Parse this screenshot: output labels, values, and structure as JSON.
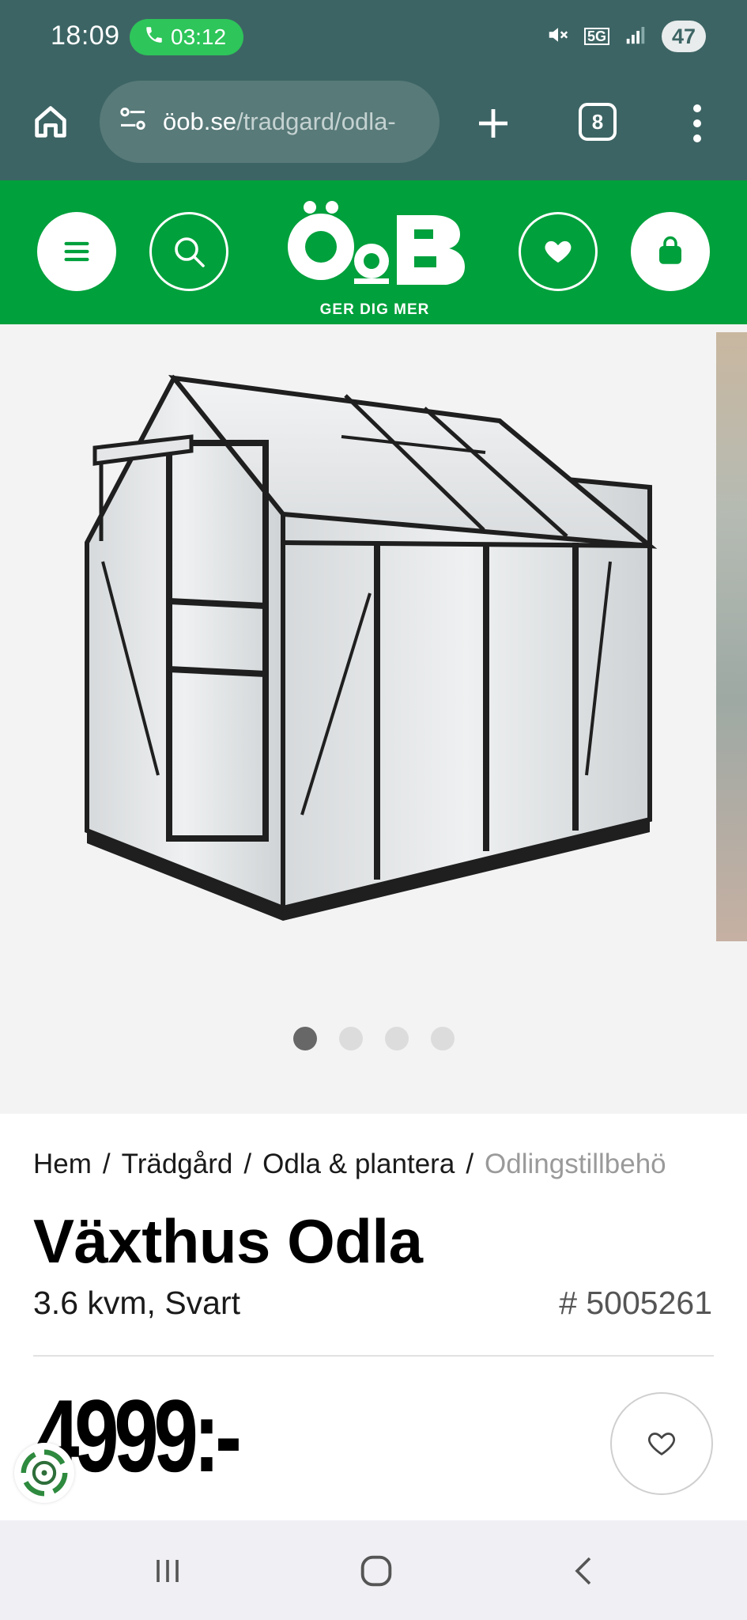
{
  "status_bar": {
    "time": "18:09",
    "call_timer": "03:12",
    "battery": "47",
    "network": "5G"
  },
  "browser": {
    "url_domain": "öob.se",
    "url_path": "/tradgard/odla-",
    "tab_count": "8"
  },
  "header": {
    "logo_text": "ÖoB",
    "logo_tagline": "GER DIG MER",
    "brand_color": "#00a03c"
  },
  "gallery": {
    "image_count": 4,
    "active_index": 1
  },
  "breadcrumb": {
    "items": [
      "Hem",
      "Trädgård",
      "Odla & plantera",
      "Odlingstillbehö"
    ],
    "separator": "/"
  },
  "product": {
    "title": "Växthus Odla",
    "subtitle": "3.6 kvm, Svart",
    "sku": "# 5005261",
    "price": "4999:-"
  },
  "icons": {
    "home": "home-icon",
    "site_settings": "site-settings-icon",
    "new_tab": "plus-icon",
    "menu": "kebab-menu-icon",
    "hamburger": "hamburger-icon",
    "search": "search-icon",
    "wishlist": "heart-icon",
    "cart": "shopping-bag-icon",
    "recents": "recent-apps-icon",
    "home_nav": "home-nav-icon",
    "back": "back-icon"
  }
}
